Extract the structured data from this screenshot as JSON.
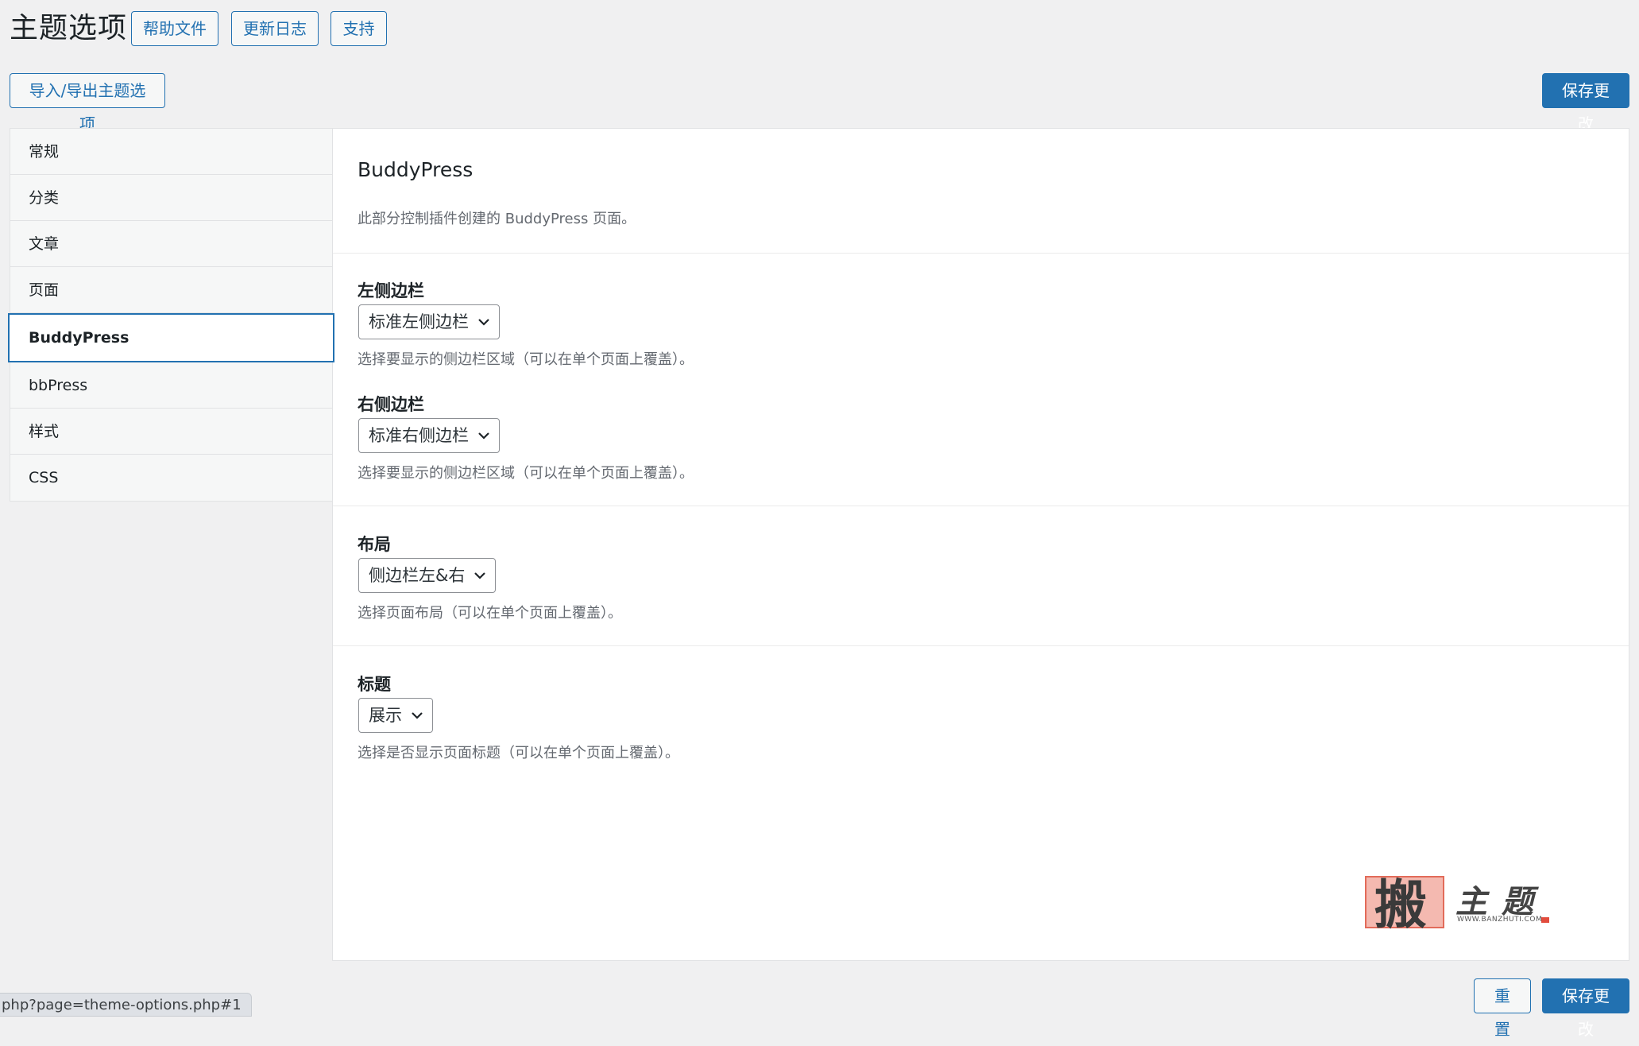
{
  "header": {
    "title": "主题选项",
    "buttons": [
      "帮助文件",
      "更新日志",
      "支持"
    ]
  },
  "toolbar": {
    "import_export_label": "导入/导出主题选项",
    "save_label": "保存更改"
  },
  "sidebar": {
    "items": [
      {
        "label": "常规"
      },
      {
        "label": "分类"
      },
      {
        "label": "文章"
      },
      {
        "label": "页面"
      },
      {
        "label": "BuddyPress",
        "active": true
      },
      {
        "label": "bbPress"
      },
      {
        "label": "样式"
      },
      {
        "label": "CSS"
      }
    ]
  },
  "main": {
    "section_title": "BuddyPress",
    "section_desc": "此部分控制插件创建的 BuddyPress 页面。",
    "fields": {
      "left_sidebar": {
        "label": "左侧边栏",
        "value": "标准左侧边栏",
        "help": "选择要显示的侧边栏区域（可以在单个页面上覆盖）。"
      },
      "right_sidebar": {
        "label": "右侧边栏",
        "value": "标准右侧边栏",
        "help": "选择要显示的侧边栏区域（可以在单个页面上覆盖）。"
      },
      "layout": {
        "label": "布局",
        "value": "侧边栏左&右",
        "help": "选择页面布局（可以在单个页面上覆盖）。"
      },
      "title": {
        "label": "标题",
        "value": "展示",
        "help": "选择是否显示页面标题（可以在单个页面上覆盖）。"
      }
    }
  },
  "footer": {
    "reset_label": "重置",
    "save_label": "保存更改"
  },
  "watermark": {
    "seal_char": "搬",
    "text": "主题",
    "url": "WWW.BANZHUTI.COM"
  },
  "status_bar": {
    "url": "php?page=theme-options.php#1"
  },
  "colors": {
    "accent": "#2271b1",
    "background": "#f0f0f1",
    "panel": "#ffffff",
    "muted_text": "#646970"
  }
}
